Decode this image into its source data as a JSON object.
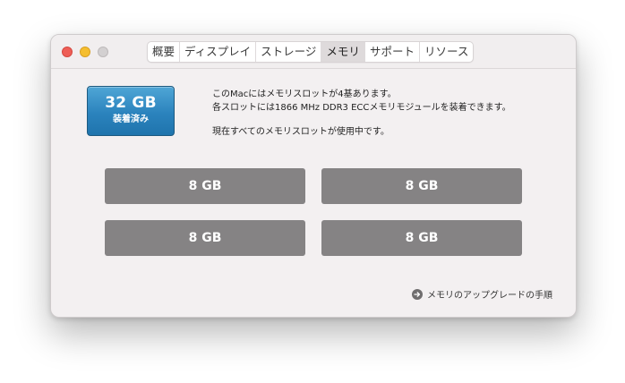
{
  "window": {
    "tabs": [
      {
        "label": "概要"
      },
      {
        "label": "ディスプレイ"
      },
      {
        "label": "ストレージ"
      },
      {
        "label": "メモリ",
        "active": true
      },
      {
        "label": "サポート"
      },
      {
        "label": "リソース"
      }
    ]
  },
  "memory": {
    "total": "32 GB",
    "installed_label": "装着済み",
    "info_lines": [
      "このMacにはメモリスロットが4基あります。",
      "各スロットには1866 MHz DDR3 ECCメモリモジュールを装着できます。",
      "現在すべてのメモリスロットが使用中です。"
    ],
    "slots": [
      "8 GB",
      "8 GB",
      "8 GB",
      "8 GB"
    ]
  },
  "footer": {
    "upgrade_link": "メモリのアップグレードの手順"
  },
  "colors": {
    "badge": "#2b83bd",
    "slot": "#858384",
    "close": "#ee5e57",
    "minimize": "#f5be2f",
    "zoom_disabled": "#d3d0d1"
  },
  "icons": {
    "upgrade_link": "arrow-right-circle-icon"
  }
}
